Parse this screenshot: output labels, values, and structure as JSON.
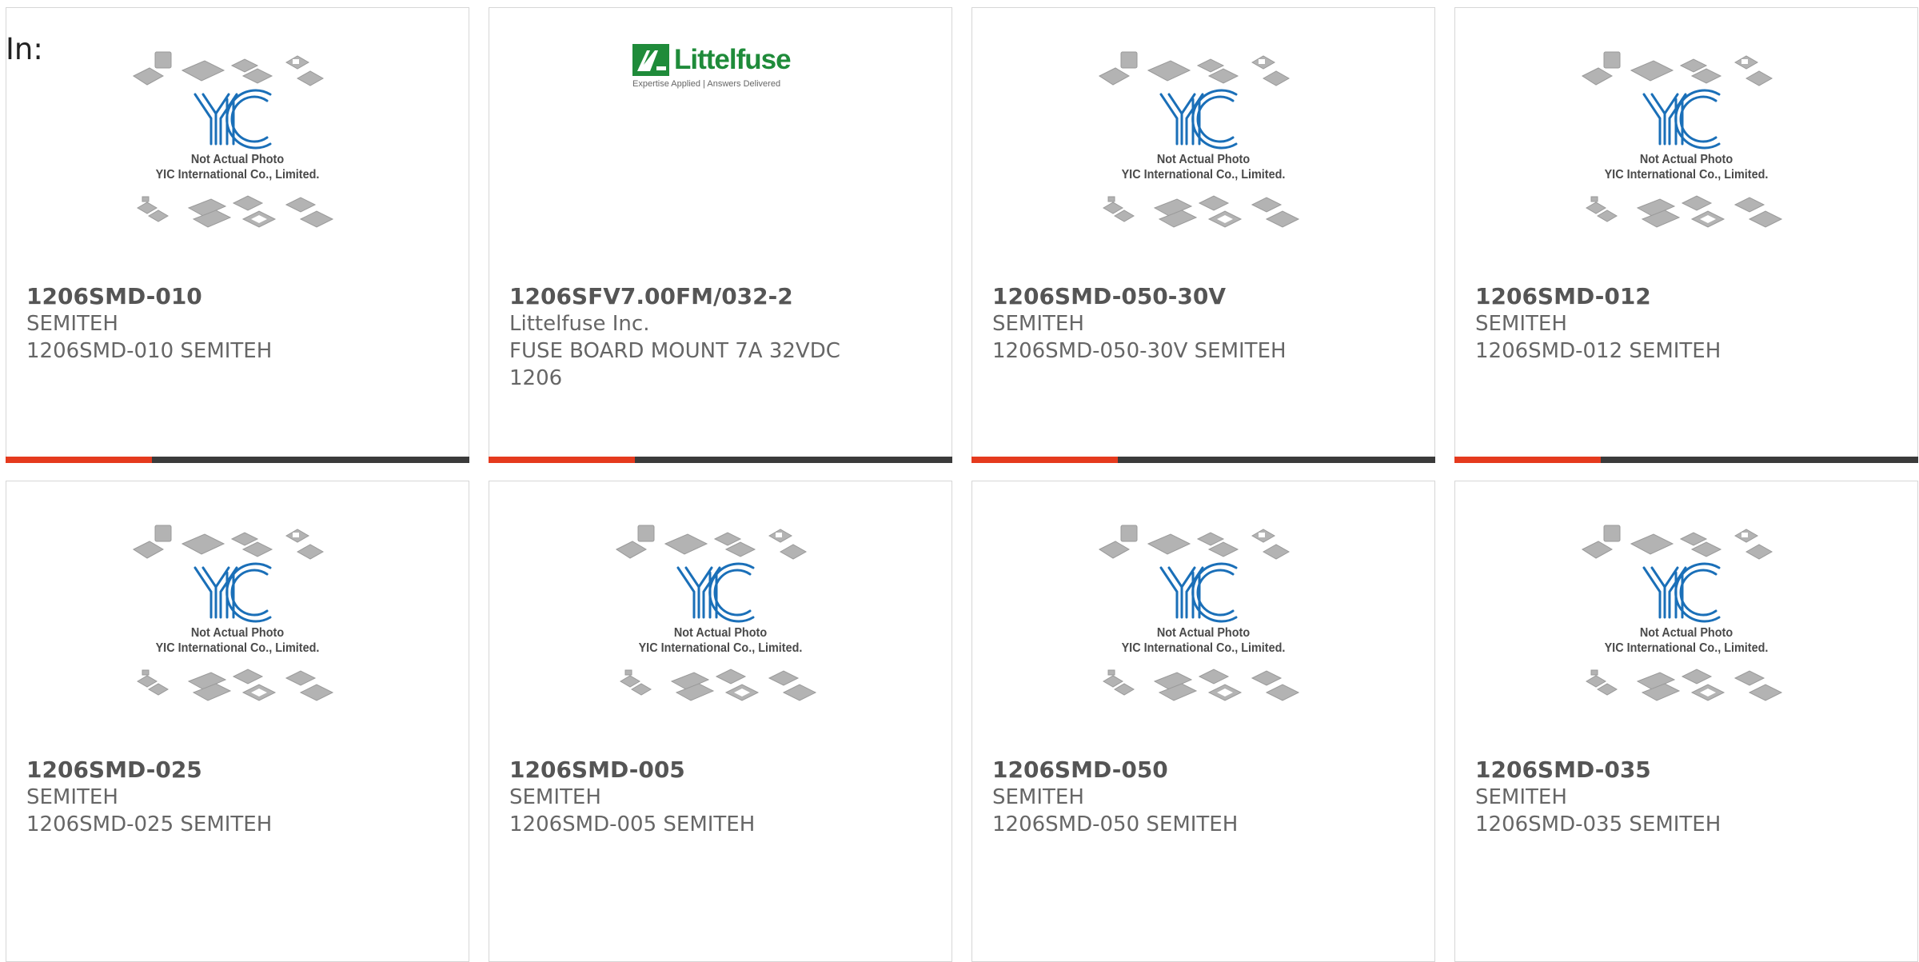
{
  "filter": {
    "label": "In:"
  },
  "placeholder": {
    "caption_line1": "Not Actual Photo",
    "caption_line2": "YIC International Co., Limited."
  },
  "littelfuse_logo": {
    "name": "Littelfuse",
    "tagline": "Expertise Applied | Answers Delivered"
  },
  "colors": {
    "accent": "#e53a1e",
    "bar_dark": "#3b3b3b",
    "yic_blue": "#1a6fb8",
    "littelfuse_green": "#1f8b3a"
  },
  "products": [
    {
      "part_number": "1206SMD-010",
      "manufacturer": "SEMITEH",
      "description": "1206SMD-010 SEMITEH",
      "image": "yic-placeholder"
    },
    {
      "part_number": "1206SFV7.00FM/032-2",
      "manufacturer": "Littelfuse Inc.",
      "description": "FUSE BOARD MOUNT 7A 32VDC 1206",
      "image": "littelfuse-logo"
    },
    {
      "part_number": "1206SMD-050-30V",
      "manufacturer": "SEMITEH",
      "description": "1206SMD-050-30V SEMITEH",
      "image": "yic-placeholder"
    },
    {
      "part_number": "1206SMD-012",
      "manufacturer": "SEMITEH",
      "description": "1206SMD-012 SEMITEH",
      "image": "yic-placeholder"
    },
    {
      "part_number": "1206SMD-025",
      "manufacturer": "SEMITEH",
      "description": "1206SMD-025 SEMITEH",
      "image": "yic-placeholder"
    },
    {
      "part_number": "1206SMD-005",
      "manufacturer": "SEMITEH",
      "description": "1206SMD-005 SEMITEH",
      "image": "yic-placeholder"
    },
    {
      "part_number": "1206SMD-050",
      "manufacturer": "SEMITEH",
      "description": "1206SMD-050 SEMITEH",
      "image": "yic-placeholder"
    },
    {
      "part_number": "1206SMD-035",
      "manufacturer": "SEMITEH",
      "description": "1206SMD-035 SEMITEH",
      "image": "yic-placeholder"
    }
  ]
}
